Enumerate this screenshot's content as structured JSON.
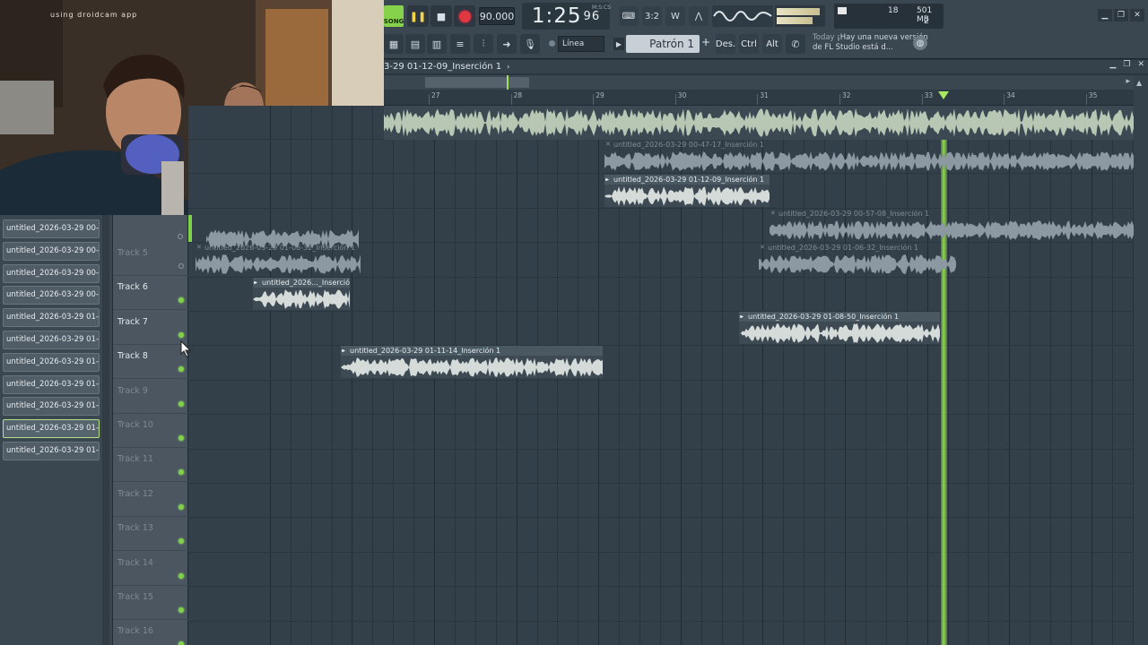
{
  "webcam": {
    "overlay_text": "using droidcam app"
  },
  "toolbar": {
    "mode_label": "SONG",
    "tempo": "90.000",
    "time_main": "1:25",
    "time_sub": "96",
    "time_unit": "M:S:CS",
    "cpu_value": "18",
    "memory": "501 MB",
    "polyphony": "2",
    "snap_label": "Línea",
    "pattern_label": "Patrón 1",
    "pattern_add": "+",
    "btn_des": "Des.",
    "btn_ctrl": "Ctrl",
    "btn_alt": "Alt",
    "news_today": "Today",
    "news_text": "¡Hay una nueva versión de FL Studio está d..."
  },
  "playlist": {
    "title": "3-29 01-12-09_Inserción 1",
    "ruler_ticks": [
      "27",
      "28",
      "29",
      "30",
      "31",
      "32",
      "33",
      "34",
      "35"
    ],
    "playhead_bar": 33.2
  },
  "browser": {
    "items": [
      "untitled_2026-03-29 00-...",
      "untitled_2026-03-29 00-...",
      "untitled_2026-03-29 00-...",
      "untitled_2026-03-29 00-...",
      "untitled_2026-03-29 01-...",
      "untitled_2026-03-29 01-...",
      "untitled_2026-03-29 01-...",
      "untitled_2026-03-29 01-...",
      "untitled_2026-03-29 01-...",
      "untitled_2026-03-29 01-...",
      "untitled_2026-03-29 01-..."
    ],
    "selected_index": 9
  },
  "tracks": [
    {
      "name": "Track 5",
      "muted": true
    },
    {
      "name": "Track 6",
      "muted": false
    },
    {
      "name": "Track 7",
      "muted": false
    },
    {
      "name": "Track 8",
      "muted": false
    },
    {
      "name": "Track 9",
      "muted": true
    },
    {
      "name": "Track 10",
      "muted": true
    },
    {
      "name": "Track 11",
      "muted": true
    },
    {
      "name": "Track 12",
      "muted": true
    },
    {
      "name": "Track 13",
      "muted": true
    },
    {
      "name": "Track 14",
      "muted": true
    },
    {
      "name": "Track 15",
      "muted": true
    },
    {
      "name": "Track 16",
      "muted": true
    }
  ],
  "clips": [
    {
      "label": "untitled_2026-03-29 00-47-17_Inserción 1",
      "state": "dim"
    },
    {
      "label": "untitled_2026-03-29 01-12-09_Inserción 1",
      "state": "active"
    },
    {
      "label": "untitled_2026-03-29 00-57-08_Inserción 1",
      "state": "dim"
    },
    {
      "label": "untitled_2026-03-29 01-06-32_Inserción 1",
      "state": "dim"
    },
    {
      "label": "untitled_2026-03-29 01-06-32_Inserción 1",
      "state": "dim"
    },
    {
      "label": "untitled_2026..._Inserción 1",
      "state": "active"
    },
    {
      "label": "untitled_2026-03-29 01-08-50_Inserción 1",
      "state": "active"
    },
    {
      "label": "untitled_2026-03-29 01-11-14_Inserción 1",
      "state": "active"
    }
  ],
  "colors": {
    "accent_green": "#8ed849",
    "record_red": "#e0383e",
    "background": "#33404a"
  }
}
